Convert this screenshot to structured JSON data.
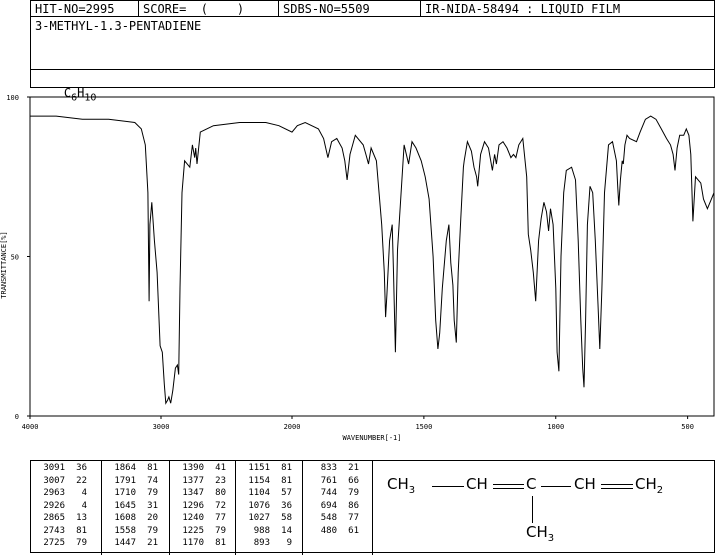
{
  "header": {
    "hit_no": "HIT-NO=2995",
    "score": "SCORE=  (    )",
    "sdbs_no": "SDBS-NO=5509",
    "ir_nida": "IR-NIDA-58494 : LIQUID FILM"
  },
  "compound": {
    "name": "3-METHYL-1.3-PENTADIENE",
    "formula_c": "C",
    "formula_c_sub": "6",
    "formula_h": "H",
    "formula_h_sub": "10"
  },
  "chart_data": {
    "type": "line",
    "ylabel": "TRANSMITTANCE[%]",
    "xlabel": "WAVENUMBER[-1]",
    "xlim": [
      4000,
      400
    ],
    "ylim": [
      0,
      100
    ],
    "x_ticks": [
      "4000",
      "3000",
      "2000",
      "1500",
      "1000",
      "500"
    ],
    "y_ticks": [
      "100",
      "50",
      "0"
    ],
    "points": [
      [
        4000,
        94
      ],
      [
        3800,
        94
      ],
      [
        3600,
        93
      ],
      [
        3400,
        93
      ],
      [
        3200,
        92
      ],
      [
        3150,
        90
      ],
      [
        3120,
        85
      ],
      [
        3100,
        70
      ],
      [
        3091,
        36
      ],
      [
        3085,
        60
      ],
      [
        3070,
        67
      ],
      [
        3050,
        55
      ],
      [
        3030,
        45
      ],
      [
        3007,
        22
      ],
      [
        2990,
        20
      ],
      [
        2975,
        10
      ],
      [
        2963,
        4
      ],
      [
        2950,
        5
      ],
      [
        2940,
        6
      ],
      [
        2926,
        4
      ],
      [
        2910,
        8
      ],
      [
        2890,
        15
      ],
      [
        2875,
        16
      ],
      [
        2865,
        13
      ],
      [
        2855,
        40
      ],
      [
        2840,
        70
      ],
      [
        2820,
        80
      ],
      [
        2780,
        78
      ],
      [
        2760,
        85
      ],
      [
        2743,
        81
      ],
      [
        2735,
        84
      ],
      [
        2725,
        79
      ],
      [
        2700,
        89
      ],
      [
        2600,
        91
      ],
      [
        2400,
        92
      ],
      [
        2200,
        92
      ],
      [
        2100,
        91
      ],
      [
        2000,
        89
      ],
      [
        1980,
        91
      ],
      [
        1950,
        92
      ],
      [
        1900,
        90
      ],
      [
        1880,
        87
      ],
      [
        1864,
        81
      ],
      [
        1850,
        86
      ],
      [
        1830,
        87
      ],
      [
        1810,
        84
      ],
      [
        1800,
        80
      ],
      [
        1791,
        74
      ],
      [
        1780,
        82
      ],
      [
        1760,
        88
      ],
      [
        1730,
        85
      ],
      [
        1720,
        82
      ],
      [
        1710,
        79
      ],
      [
        1700,
        84
      ],
      [
        1680,
        80
      ],
      [
        1660,
        60
      ],
      [
        1650,
        45
      ],
      [
        1645,
        31
      ],
      [
        1640,
        38
      ],
      [
        1630,
        55
      ],
      [
        1620,
        60
      ],
      [
        1615,
        45
      ],
      [
        1608,
        20
      ],
      [
        1600,
        52
      ],
      [
        1590,
        65
      ],
      [
        1575,
        85
      ],
      [
        1558,
        79
      ],
      [
        1545,
        86
      ],
      [
        1530,
        84
      ],
      [
        1510,
        80
      ],
      [
        1495,
        75
      ],
      [
        1480,
        68
      ],
      [
        1465,
        50
      ],
      [
        1455,
        30
      ],
      [
        1447,
        21
      ],
      [
        1440,
        26
      ],
      [
        1430,
        40
      ],
      [
        1415,
        55
      ],
      [
        1405,
        60
      ],
      [
        1398,
        48
      ],
      [
        1390,
        41
      ],
      [
        1385,
        30
      ],
      [
        1377,
        23
      ],
      [
        1370,
        45
      ],
      [
        1360,
        62
      ],
      [
        1350,
        78
      ],
      [
        1347,
        80
      ],
      [
        1335,
        86
      ],
      [
        1320,
        83
      ],
      [
        1310,
        78
      ],
      [
        1300,
        75
      ],
      [
        1296,
        72
      ],
      [
        1285,
        82
      ],
      [
        1270,
        86
      ],
      [
        1255,
        84
      ],
      [
        1240,
        77
      ],
      [
        1232,
        82
      ],
      [
        1225,
        79
      ],
      [
        1215,
        85
      ],
      [
        1200,
        86
      ],
      [
        1185,
        84
      ],
      [
        1170,
        81
      ],
      [
        1160,
        82
      ],
      [
        1151,
        81
      ],
      [
        1140,
        85
      ],
      [
        1125,
        87
      ],
      [
        1110,
        75
      ],
      [
        1104,
        57
      ],
      [
        1095,
        52
      ],
      [
        1085,
        45
      ],
      [
        1076,
        36
      ],
      [
        1065,
        55
      ],
      [
        1055,
        62
      ],
      [
        1045,
        67
      ],
      [
        1035,
        64
      ],
      [
        1027,
        58
      ],
      [
        1020,
        65
      ],
      [
        1010,
        60
      ],
      [
        1000,
        40
      ],
      [
        995,
        20
      ],
      [
        988,
        14
      ],
      [
        980,
        50
      ],
      [
        970,
        70
      ],
      [
        960,
        77
      ],
      [
        940,
        78
      ],
      [
        925,
        74
      ],
      [
        915,
        55
      ],
      [
        905,
        30
      ],
      [
        898,
        15
      ],
      [
        893,
        9
      ],
      [
        887,
        30
      ],
      [
        880,
        60
      ],
      [
        870,
        72
      ],
      [
        860,
        70
      ],
      [
        850,
        55
      ],
      [
        840,
        35
      ],
      [
        833,
        21
      ],
      [
        825,
        40
      ],
      [
        815,
        70
      ],
      [
        800,
        85
      ],
      [
        785,
        86
      ],
      [
        770,
        80
      ],
      [
        765,
        72
      ],
      [
        761,
        66
      ],
      [
        755,
        74
      ],
      [
        748,
        80
      ],
      [
        744,
        79
      ],
      [
        738,
        85
      ],
      [
        730,
        88
      ],
      [
        720,
        87
      ],
      [
        694,
        86
      ],
      [
        680,
        89
      ],
      [
        660,
        93
      ],
      [
        640,
        94
      ],
      [
        620,
        93
      ],
      [
        600,
        90
      ],
      [
        580,
        87
      ],
      [
        565,
        85
      ],
      [
        555,
        82
      ],
      [
        548,
        77
      ],
      [
        540,
        84
      ],
      [
        530,
        88
      ],
      [
        515,
        88
      ],
      [
        505,
        90
      ],
      [
        495,
        88
      ],
      [
        488,
        82
      ],
      [
        480,
        61
      ],
      [
        470,
        75
      ],
      [
        450,
        73
      ],
      [
        440,
        68
      ],
      [
        425,
        65
      ],
      [
        410,
        68
      ],
      [
        400,
        70
      ]
    ],
    "peaks": [
      [
        "3091",
        "36"
      ],
      [
        "3007",
        "22"
      ],
      [
        "2963",
        "4"
      ],
      [
        "2926",
        "4"
      ],
      [
        "2865",
        "13"
      ],
      [
        "2743",
        "81"
      ],
      [
        "2725",
        "79"
      ],
      [
        "1864",
        "81"
      ],
      [
        "1791",
        "74"
      ],
      [
        "1710",
        "79"
      ],
      [
        "1645",
        "31"
      ],
      [
        "1608",
        "20"
      ],
      [
        "1558",
        "79"
      ],
      [
        "1447",
        "21"
      ],
      [
        "1390",
        "41"
      ],
      [
        "1377",
        "23"
      ],
      [
        "1347",
        "80"
      ],
      [
        "1296",
        "72"
      ],
      [
        "1240",
        "77"
      ],
      [
        "1225",
        "79"
      ],
      [
        "1170",
        "81"
      ],
      [
        "1151",
        "81"
      ],
      [
        "1154",
        "81"
      ],
      [
        "1104",
        "57"
      ],
      [
        "1076",
        "36"
      ],
      [
        "1027",
        "58"
      ],
      [
        "988",
        "14"
      ],
      [
        "893",
        "9"
      ],
      [
        "833",
        "21"
      ],
      [
        "761",
        "66"
      ],
      [
        "744",
        "79"
      ],
      [
        "694",
        "86"
      ],
      [
        "548",
        "77"
      ],
      [
        "480",
        "61"
      ]
    ]
  },
  "peak_table": {
    "col1": [
      [
        "3091",
        "36"
      ],
      [
        "3007",
        "22"
      ],
      [
        "2963",
        "4"
      ],
      [
        "2926",
        "4"
      ],
      [
        "2865",
        "13"
      ],
      [
        "2743",
        "81"
      ],
      [
        "2725",
        "79"
      ]
    ],
    "col2": [
      [
        "1864",
        "81"
      ],
      [
        "1791",
        "74"
      ],
      [
        "1710",
        "79"
      ],
      [
        "1645",
        "31"
      ],
      [
        "1608",
        "20"
      ],
      [
        "1558",
        "79"
      ],
      [
        "1447",
        "21"
      ]
    ],
    "col3": [
      [
        "1390",
        "41"
      ],
      [
        "1377",
        "23"
      ],
      [
        "1347",
        "80"
      ],
      [
        "1296",
        "72"
      ],
      [
        "1240",
        "77"
      ],
      [
        "1225",
        "79"
      ],
      [
        "1170",
        "81"
      ]
    ],
    "col4": [
      [
        "1151",
        "81"
      ],
      [
        "1154",
        "81"
      ],
      [
        "1104",
        "57"
      ],
      [
        "1076",
        "36"
      ],
      [
        "1027",
        "58"
      ],
      [
        "988",
        "14"
      ],
      [
        "893",
        "9"
      ]
    ],
    "col5": [
      [
        "833",
        "21"
      ],
      [
        "761",
        "66"
      ],
      [
        "744",
        "79"
      ],
      [
        "694",
        "86"
      ],
      [
        "548",
        "77"
      ],
      [
        "480",
        "61"
      ],
      [
        "",
        ""
      ]
    ]
  },
  "structure": {
    "ch3": "CH",
    "ch3_sub": "3",
    "ch_a": "CH",
    "c": "C",
    "ch_b": "CH",
    "ch2": "CH",
    "ch2_sub": "2",
    "methyl": "CH",
    "methyl_sub": "3"
  }
}
